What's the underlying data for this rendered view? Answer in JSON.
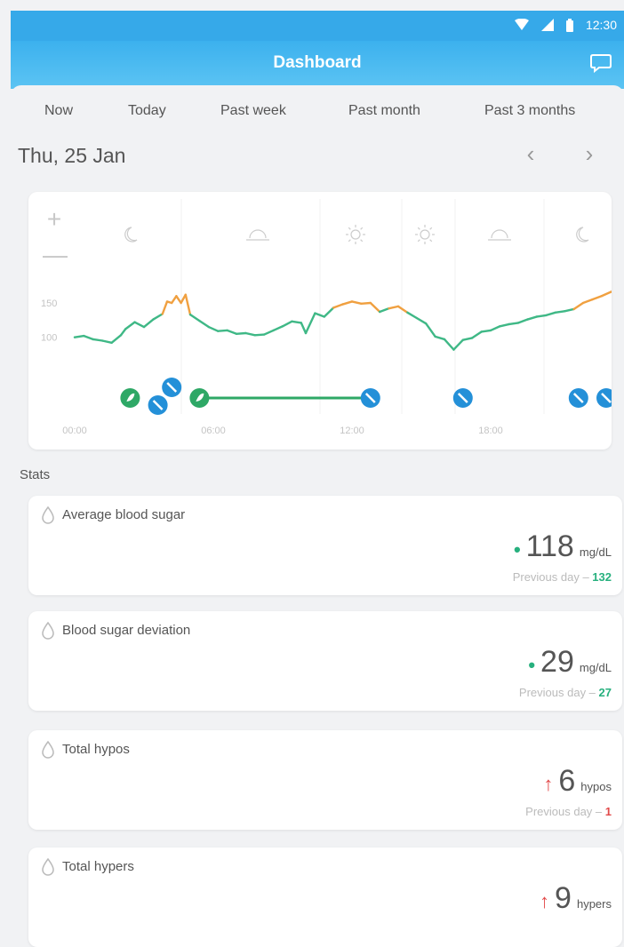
{
  "status_bar": {
    "time": "12:30",
    "icons": [
      "wifi-icon",
      "signal-icon",
      "battery-icon"
    ]
  },
  "app_bar": {
    "title": "Dashboard",
    "action_icon": "chat-icon"
  },
  "tabs": [
    {
      "label": "Now"
    },
    {
      "label": "Today"
    },
    {
      "label": "Past week"
    },
    {
      "label": "Past month"
    },
    {
      "label": "Past 3 months"
    }
  ],
  "date": {
    "label": "Thu, 25 Jan",
    "prev_icon": "chevron-left-icon",
    "next_icon": "chevron-right-icon"
  },
  "chart": {
    "zoom_in": "+",
    "zoom_out": "—",
    "time_of_day_icons": [
      "moon-icon",
      "sunrise-icon",
      "sun-icon",
      "sun-icon",
      "sunset-icon",
      "moon-icon"
    ],
    "markers_icons": [
      "food-marker-icon",
      "insulin-marker-icon"
    ]
  },
  "chart_data": {
    "type": "line",
    "title": "",
    "xlabel": "",
    "ylabel": "",
    "x_ticks": [
      "00:00",
      "06:00",
      "12:00",
      "18:00"
    ],
    "y_ticks": [
      "150",
      "100"
    ],
    "xlim": [
      0,
      24
    ],
    "ylim": [
      40,
      260
    ],
    "series": [
      {
        "x": [
          0,
          0.4,
          0.8,
          1.2,
          1.6,
          2.0,
          2.2,
          2.6,
          3.0,
          3.4,
          3.8,
          4.0,
          4.2,
          4.4,
          4.6,
          4.8,
          5.0,
          5.4,
          5.8,
          6.2,
          6.6,
          7.0,
          7.4,
          7.8,
          8.2,
          8.6,
          9.0,
          9.4,
          9.8,
          10.0,
          10.4,
          10.8,
          11.2,
          11.6,
          12.0,
          12.4,
          12.8,
          13.2,
          13.6,
          14.0,
          14.4,
          14.8,
          15.2,
          15.6,
          16.0,
          16.4,
          16.8,
          17.2,
          17.6,
          18.0,
          18.4,
          18.8,
          19.2,
          19.6,
          20.0,
          20.4,
          20.8,
          21.2,
          21.6,
          22.0,
          22.4,
          22.8,
          23.2,
          23.6,
          24.0
        ],
        "y": [
          100,
          102,
          97,
          95,
          92,
          103,
          112,
          122,
          115,
          126,
          134,
          152,
          150,
          160,
          150,
          162,
          133,
          124,
          115,
          109,
          110,
          105,
          106,
          103,
          104,
          110,
          116,
          123,
          121,
          106,
          135,
          130,
          143,
          148,
          152,
          149,
          150,
          137,
          142,
          145,
          136,
          128,
          120,
          101,
          97,
          82,
          96,
          99,
          108,
          110,
          116,
          119,
          121,
          126,
          130,
          132,
          136,
          138,
          141,
          150,
          155,
          160,
          166,
          172,
          166
        ]
      }
    ],
    "color_thresholds": {
      "low_below": 85,
      "high_above": 140
    },
    "food_markers_x": [
      2.4,
      5.4
    ],
    "insulin_markers_x": [
      3.6,
      4.2,
      12.8,
      16.8,
      21.8,
      23.0
    ],
    "event_bar": {
      "x_start": 5.4,
      "x_end": 12.8
    }
  },
  "stats": {
    "heading": "Stats",
    "cards": [
      {
        "title": "Average blood sugar",
        "indicator": "•",
        "indicator_color": "#27b07e",
        "value": "118",
        "unit": "mg/dL",
        "prev_label": "Previous day – ",
        "prev_value": "132",
        "prev_color": "#27b07e"
      },
      {
        "title": "Blood sugar deviation",
        "indicator": "•",
        "indicator_color": "#27b07e",
        "value": "29",
        "unit": "mg/dL",
        "prev_label": "Previous day – ",
        "prev_value": "27",
        "prev_color": "#27b07e"
      },
      {
        "title": "Total hypos",
        "indicator": "↑",
        "indicator_color": "#e24a4a",
        "value": "6",
        "unit": "hypos",
        "prev_label": "Previous day – ",
        "prev_value": "1",
        "prev_color": "#e24a4a"
      },
      {
        "title": "Total hypers",
        "indicator": "↑",
        "indicator_color": "#e24a4a",
        "value": "9",
        "unit": "hypers"
      }
    ]
  },
  "colors": {
    "primary": "#36a9e9",
    "line_green": "#3fb886",
    "line_orange": "#f0a040",
    "line_red": "#e24a4a",
    "marker_green": "#2ea866",
    "marker_blue": "#2490d8"
  }
}
